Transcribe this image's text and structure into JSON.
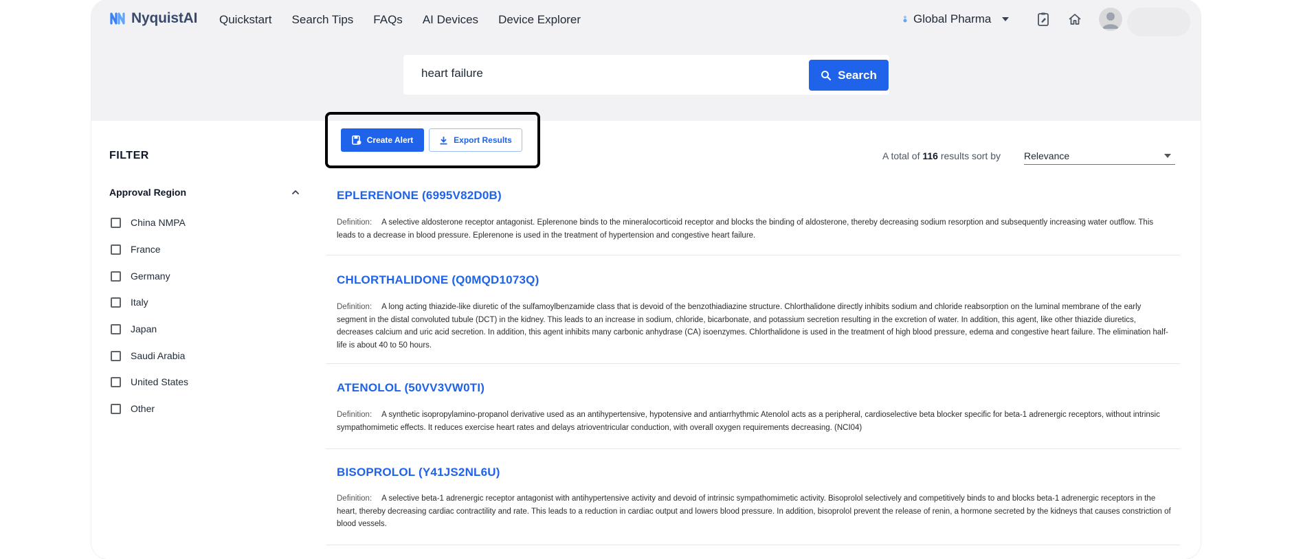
{
  "brand": {
    "name": "NyquistAI",
    "accent": "#1e63e9"
  },
  "nav": [
    "Quickstart",
    "Search Tips",
    "FAQs",
    "AI Devices",
    "Device Explorer"
  ],
  "header": {
    "org": "Global Pharma"
  },
  "search": {
    "query": "heart failure",
    "button": "Search"
  },
  "filter": {
    "title": "FILTER",
    "region_title": "Approval Region",
    "options": [
      "China NMPA",
      "France",
      "Germany",
      "Italy",
      "Japan",
      "Saudi Arabia",
      "United States",
      "Other"
    ]
  },
  "actions": {
    "create_alert": "Create Alert",
    "export_results": "Export Results"
  },
  "summary": {
    "prefix": "A total of",
    "count": "116",
    "suffix": "results sort by",
    "sort_value": "Relevance"
  },
  "results": [
    {
      "title": "EPLERENONE  (6995V82D0B)",
      "def_label": "Definition:",
      "definition": "A selective aldosterone receptor antagonist. Eplerenone binds to the mineralocorticoid receptor and blocks the binding of aldosterone, thereby decreasing sodium resorption and subsequently increasing water outflow. This leads to a decrease in blood pressure. Eplerenone is used in the treatment of hypertension and congestive heart failure."
    },
    {
      "title": "CHLORTHALIDONE  (Q0MQD1073Q)",
      "def_label": "Definition:",
      "definition": "A long acting thiazide-like diuretic of the sulfamoylbenzamide class that is devoid of the benzothiadiazine structure. Chlorthalidone directly inhibits sodium and chloride reabsorption on the luminal membrane of the early segment in the distal convoluted tubule (DCT) in the kidney. This leads to an increase in sodium, chloride, bicarbonate, and potassium secretion resulting in the excretion of water. In addition, this agent, like other thiazide diuretics, decreases calcium and uric acid secretion. In addition, this agent inhibits many carbonic anhydrase (CA) isoenzymes. Chlorthalidone is used in the treatment of high blood pressure, edema and congestive heart failure. The elimination half-life is about 40 to 50 hours."
    },
    {
      "title": "ATENOLOL  (50VV3VW0TI)",
      "def_label": "Definition:",
      "definition": "A synthetic isopropylamino-propanol derivative used as an antihypertensive, hypotensive and antiarrhythmic Atenolol acts as a peripheral, cardioselective beta blocker specific for beta-1 adrenergic receptors, without intrinsic sympathomimetic effects. It reduces exercise heart rates and delays atrioventricular conduction, with overall oxygen requirements decreasing. (NCI04)"
    },
    {
      "title": "BISOPROLOL  (Y41JS2NL6U)",
      "def_label": "Definition:",
      "definition": "A selective beta-1 adrenergic receptor antagonist with antihypertensive activity and devoid of intrinsic sympathomimetic activity. Bisoprolol selectively and competitively binds to and blocks beta-1 adrenergic receptors in the heart, thereby decreasing cardiac contractility and rate. This leads to a reduction in cardiac output and lowers blood pressure. In addition, bisoprolol prevent the release of renin, a hormone secreted by the kidneys that causes constriction of blood vessels."
    }
  ]
}
